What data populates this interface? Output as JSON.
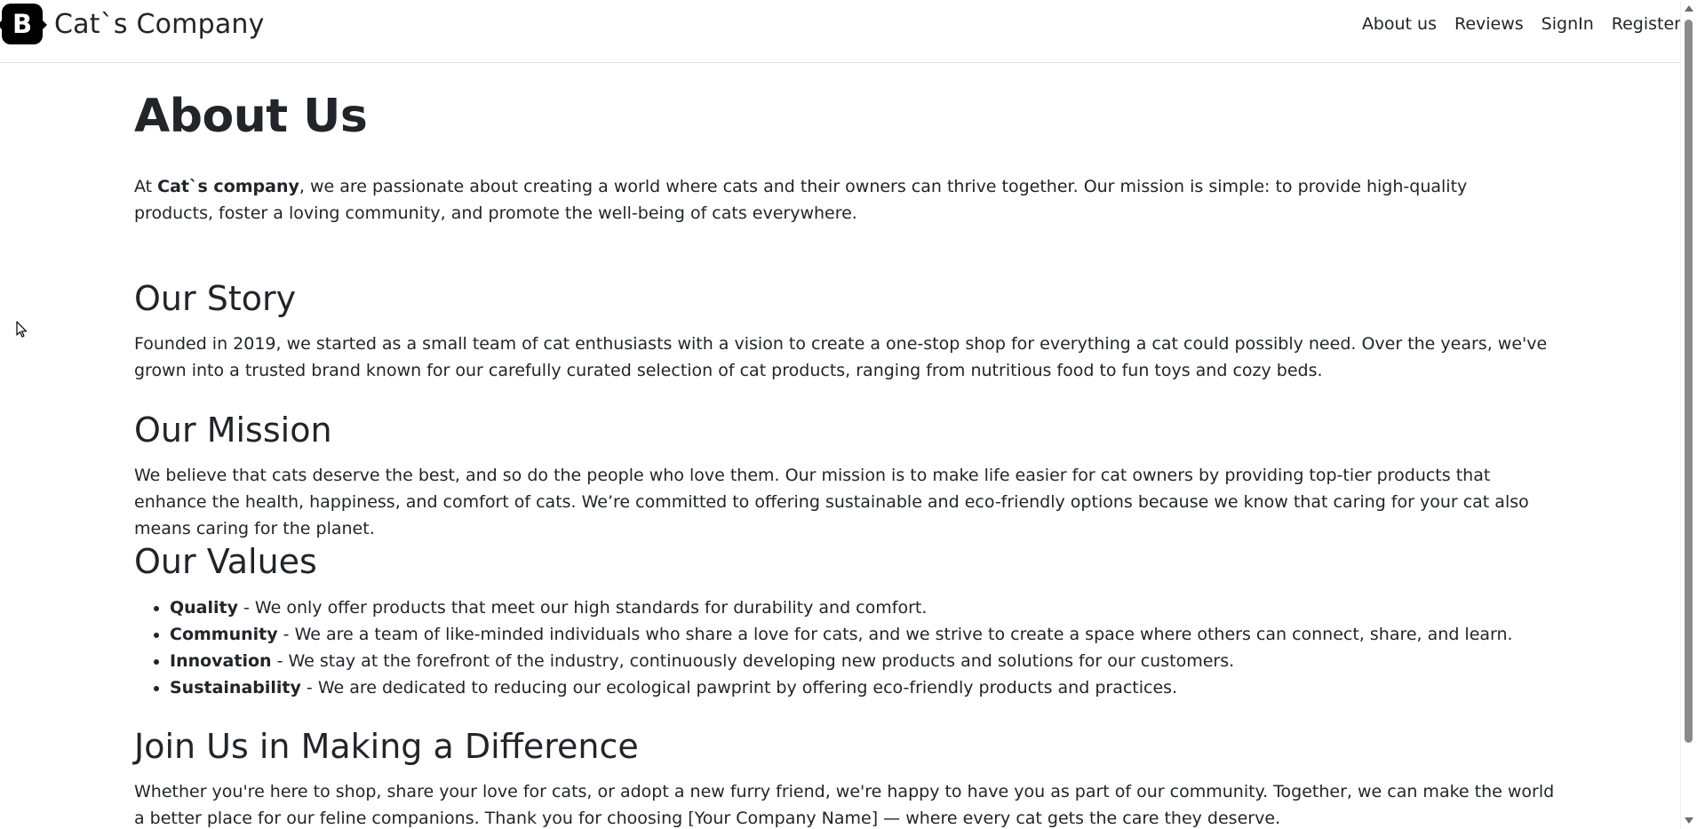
{
  "header": {
    "logo_letter": "B",
    "brand_name": "Cat`s Company",
    "nav": [
      {
        "label": "About us"
      },
      {
        "label": "Reviews"
      },
      {
        "label": "SignIn"
      },
      {
        "label": "Register"
      }
    ]
  },
  "main": {
    "title": "About Us",
    "intro": {
      "prefix": "At ",
      "company": "Cat`s company",
      "text": ", we are passionate about creating a world where cats and their owners can thrive together. Our mission is simple: to provide high-quality products, foster a loving community, and promote the well-being of cats everywhere."
    },
    "story": {
      "heading": "Our Story",
      "text": "Founded in 2019, we started as a small team of cat enthusiasts with a vision to create a one-stop shop for everything a cat could possibly need. Over the years, we've grown into a trusted brand known for our carefully curated selection of cat products, ranging from nutritious food to fun toys and cozy beds."
    },
    "mission": {
      "heading": "Our Mission",
      "text": "We believe that cats deserve the best, and so do the people who love them. Our mission is to make life easier for cat owners by providing top-tier products that enhance the health, happiness, and comfort of cats. We’re committed to offering sustainable and eco-friendly options because we know that caring for your cat also means caring for the planet."
    },
    "values": {
      "heading": "Our Values",
      "items": [
        {
          "term": "Quality",
          "text": " - We only offer products that meet our high standards for durability and comfort."
        },
        {
          "term": "Community",
          "text": " - We are a team of like-minded individuals who share a love for cats, and we strive to create a space where others can connect, share, and learn."
        },
        {
          "term": "Innovation",
          "text": " - We stay at the forefront of the industry, continuously developing new products and solutions for our customers."
        },
        {
          "term": "Sustainability",
          "text": " - We are dedicated to reducing our ecological pawprint by offering eco-friendly products and practices."
        }
      ]
    },
    "join": {
      "heading": "Join Us in Making a Difference",
      "text": "Whether you're here to shop, share your love for cats, or adopt a new furry friend, we're happy to have you as part of our community. Together, we can make the world a better place for our feline companions. Thank you for choosing [Your Company Name] — where every cat gets the care they deserve."
    }
  }
}
